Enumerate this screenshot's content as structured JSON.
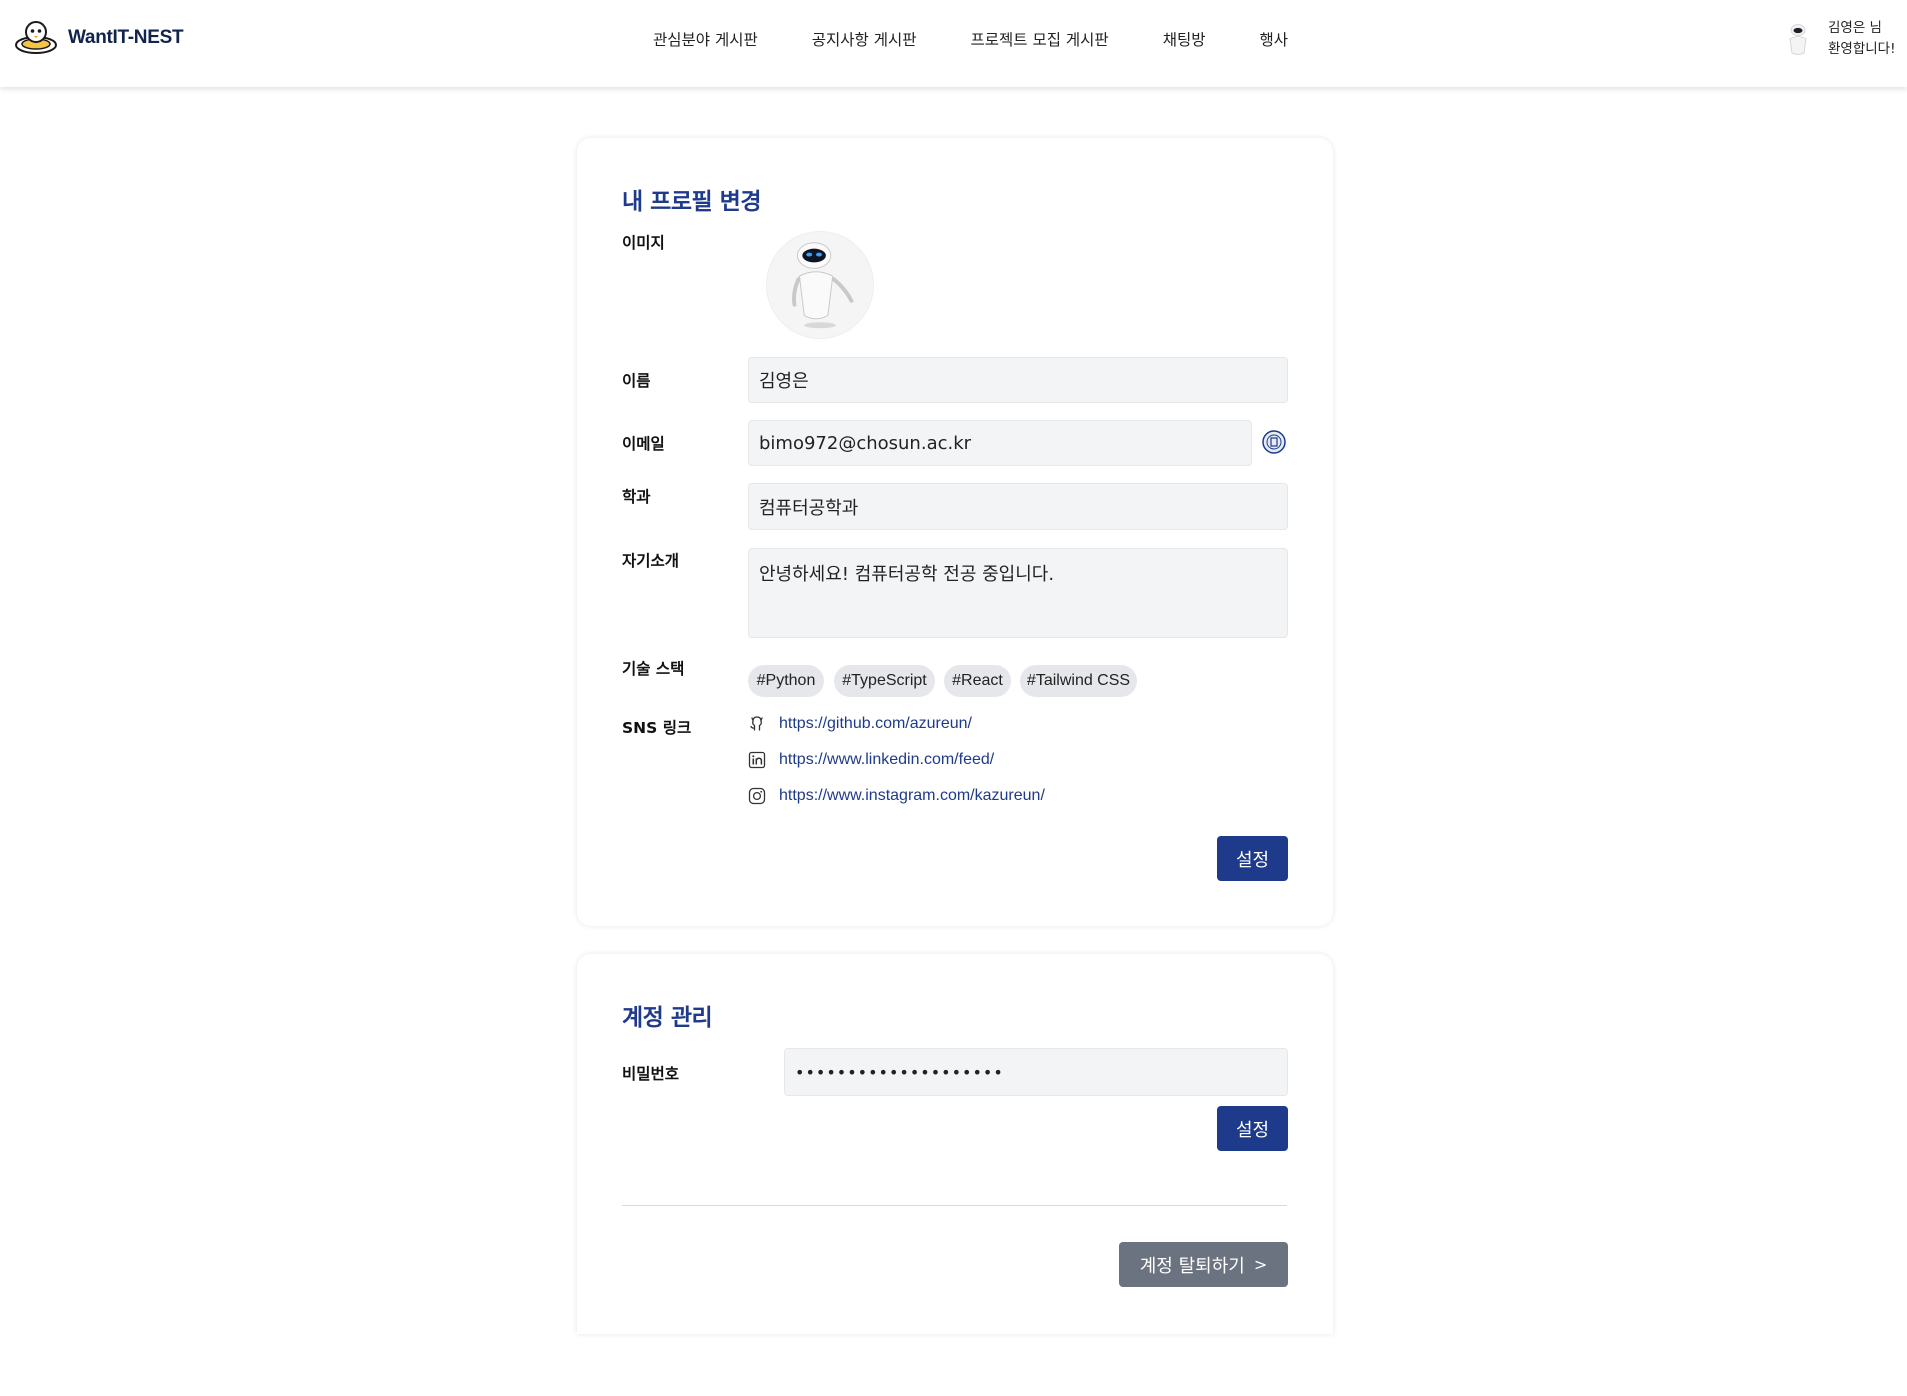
{
  "header": {
    "brand": "WantIT-NEST",
    "nav": [
      "관심분야 게시판",
      "공지사항 게시판",
      "프로젝트 모집 게시판",
      "채팅방",
      "행사"
    ],
    "user_line1": "김영은 님",
    "user_line2": "환영합니다!"
  },
  "profile": {
    "title": "내 프로필 변경",
    "image_label": "이미지",
    "name_label": "이름",
    "name_value": "김영은",
    "email_label": "이메일",
    "email_value": "bimo972@chosun.ac.kr",
    "dept_label": "학과",
    "dept_value": "컴퓨터공학과",
    "intro_label": "자기소개",
    "intro_value": "안녕하세요! 컴퓨터공학 전공 중입니다.",
    "stack_label": "기술 스택",
    "tags": [
      "#Python",
      "#TypeScript",
      "#React",
      "#Tailwind CSS"
    ],
    "sns_label": "SNS 링크",
    "sns_links": [
      {
        "icon": "github-icon",
        "url": "https://github.com/azureun/"
      },
      {
        "icon": "linkedin-icon",
        "url": "https://www.linkedin.com/feed/"
      },
      {
        "icon": "instagram-icon",
        "url": "https://www.instagram.com/kazureun/"
      }
    ],
    "save_label": "설정"
  },
  "account": {
    "title": "계정 관리",
    "password_label": "비밀번호",
    "password_value": "••••••••••••••••••••",
    "save_label": "설정",
    "withdraw_label": "계정 탈퇴하기"
  },
  "colors": {
    "accent": "#1e3a8a",
    "field_bg": "#f3f4f6",
    "tag_bg": "#e5e7eb",
    "withdraw_bg": "#6b7280"
  }
}
